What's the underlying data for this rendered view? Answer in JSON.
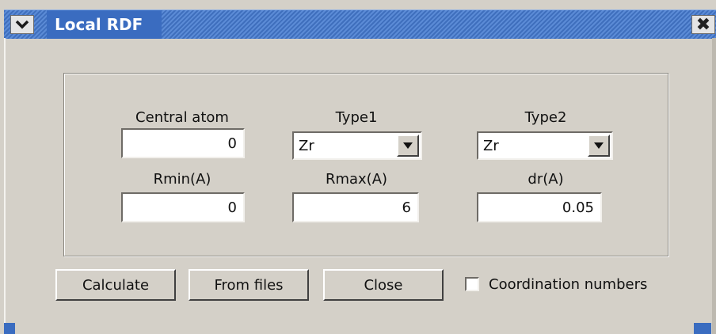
{
  "window": {
    "title": "Local RDF",
    "menu_icon": "chevron-down-icon",
    "close_icon": "close-icon"
  },
  "form": {
    "central_atom": {
      "label": "Central atom",
      "value": "0"
    },
    "type1": {
      "label": "Type1",
      "selected": "Zr"
    },
    "type2": {
      "label": "Type2",
      "selected": "Zr"
    },
    "rmin": {
      "label": "Rmin(A)",
      "value": "0"
    },
    "rmax": {
      "label": "Rmax(A)",
      "value": "6"
    },
    "dr": {
      "label": "dr(A)",
      "value": "0.05"
    }
  },
  "buttons": {
    "calculate": "Calculate",
    "from_files": "From files",
    "close": "Close"
  },
  "options": {
    "coordination_numbers": {
      "label": "Coordination numbers",
      "checked": false
    }
  },
  "colors": {
    "titlebar": "#3a6cc0",
    "window_bg": "#d4d0c8"
  }
}
